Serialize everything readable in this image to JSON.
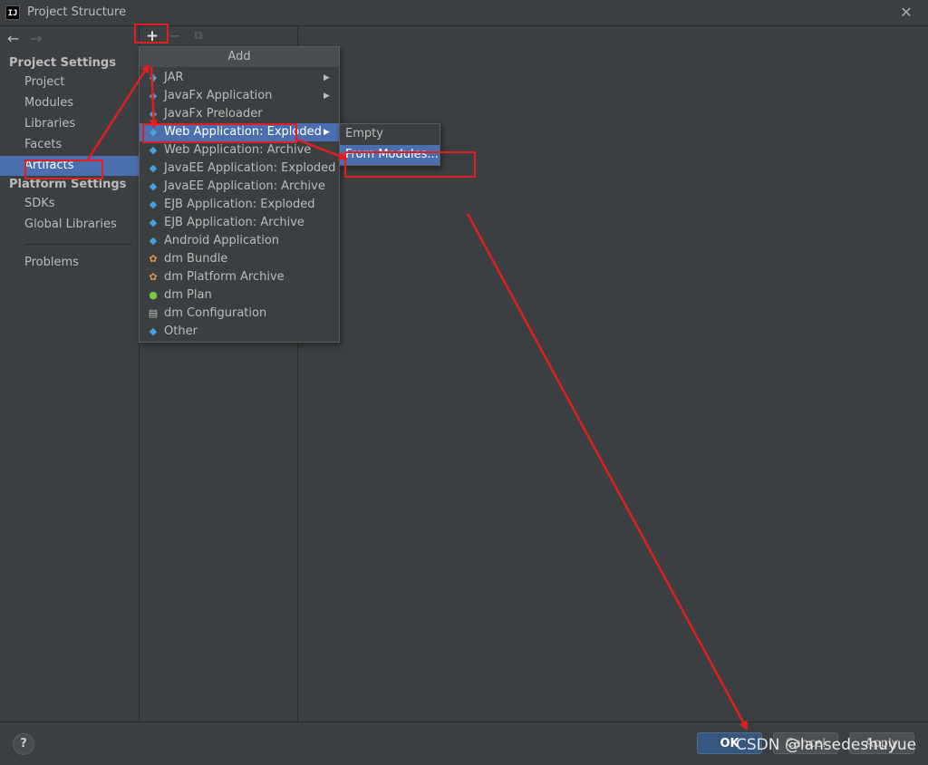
{
  "window": {
    "title": "Project Structure",
    "app_icon": "IJ",
    "close_icon": "✕"
  },
  "nav": {
    "back_icon": "←",
    "forward_icon": "→"
  },
  "sidebar": {
    "project_settings_header": "Project Settings",
    "project_items": [
      "Project",
      "Modules",
      "Libraries",
      "Facets",
      "Artifacts"
    ],
    "selected_item": "Artifacts",
    "platform_settings_header": "Platform Settings",
    "platform_items": [
      "SDKs",
      "Global Libraries"
    ],
    "problems": "Problems"
  },
  "toolbar": {
    "add_icon": "+",
    "remove_icon": "−",
    "copy_icon": "⧉"
  },
  "add_menu": {
    "title": "Add",
    "items": [
      {
        "label": "JAR",
        "icon": "diamond-icon",
        "submenu": true
      },
      {
        "label": "JavaFx Application",
        "icon": "diamond-icon",
        "submenu": true
      },
      {
        "label": "JavaFx Preloader",
        "icon": "diamond-icon",
        "submenu": false
      },
      {
        "label": "Web Application: Exploded",
        "icon": "web-icon",
        "submenu": true,
        "selected": true
      },
      {
        "label": "Web Application: Archive",
        "icon": "web-icon",
        "submenu": false
      },
      {
        "label": "JavaEE Application: Exploded",
        "icon": "javaee-icon",
        "submenu": false
      },
      {
        "label": "JavaEE Application: Archive",
        "icon": "javaee-icon",
        "submenu": false
      },
      {
        "label": "EJB Application: Exploded",
        "icon": "ejb-icon",
        "submenu": false
      },
      {
        "label": "EJB Application: Archive",
        "icon": "ejb-icon",
        "submenu": false
      },
      {
        "label": "Android Application",
        "icon": "diamond-icon",
        "submenu": false
      },
      {
        "label": "dm Bundle",
        "icon": "bundle-icon",
        "submenu": false
      },
      {
        "label": "dm Platform Archive",
        "icon": "bundle-icon",
        "submenu": false
      },
      {
        "label": "dm Plan",
        "icon": "plan-icon",
        "submenu": false
      },
      {
        "label": "dm Configuration",
        "icon": "document-icon",
        "submenu": false
      },
      {
        "label": "Other",
        "icon": "diamond-icon",
        "submenu": false
      }
    ]
  },
  "submenu": {
    "items": [
      "Empty",
      "From Modules..."
    ],
    "selected": "From Modules..."
  },
  "footer": {
    "help_label": "?",
    "ok_label": "OK",
    "cancel_label": "Cancel",
    "apply_label": "Apply",
    "watermark": "CSDN @lansedeshuyue"
  },
  "colors": {
    "background": "#3c3f41",
    "selection": "#4b6eaf",
    "annotation": "#e02020",
    "ok_button": "#365880"
  }
}
